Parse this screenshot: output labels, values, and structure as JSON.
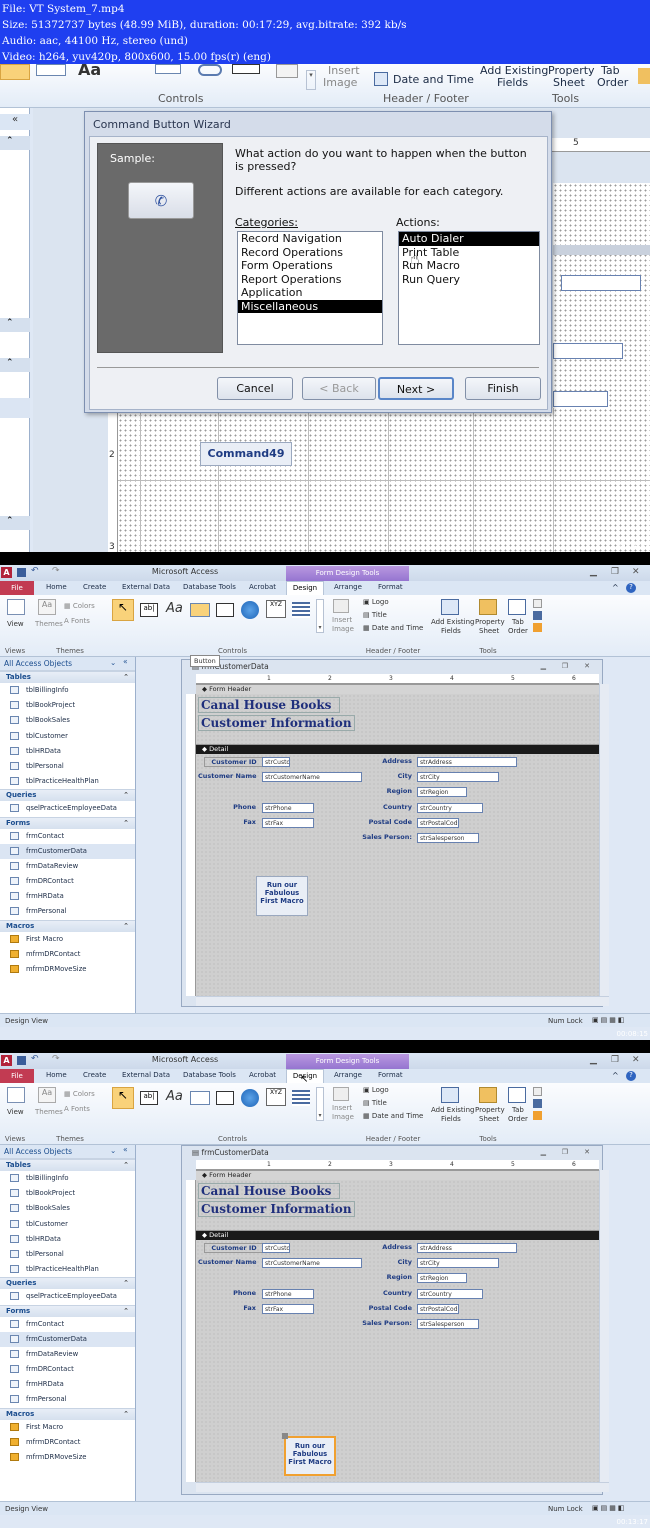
{
  "info": {
    "line1": "File: VT System_7.mp4",
    "line2": "Size: 51372737 bytes (48.99 MiB), duration: 00:17:29, avg.bitrate: 392 kb/s",
    "line3": "Audio: aac, 44100 Hz, stereo (und)",
    "line4": "Video: h264, yuv420p, 800x600, 15.00 fps(r) (eng)"
  },
  "frame1": {
    "timestamp": "00:04:35",
    "ribbon": {
      "insert_image": "Insert",
      "insert_image2": "Image",
      "date_time": "Date and Time",
      "add_fields": "Add Existing",
      "add_fields2": "Fields",
      "property": "Property",
      "property2": "Sheet",
      "tab_order": "Tab",
      "tab_order2": "Order",
      "grp_controls": "Controls",
      "grp_header": "Header / Footer",
      "grp_tools": "Tools"
    },
    "ruler_mark": "5",
    "wizard": {
      "title": "Command Button Wizard",
      "sample_label": "Sample:",
      "question": "What action do you want to happen when the button is pressed?",
      "help": "Different actions are available for each category.",
      "categories_label": "Categories:",
      "actions_label": "Actions:",
      "categories": [
        "Record Navigation",
        "Record Operations",
        "Form Operations",
        "Report Operations",
        "Application",
        "Miscellaneous"
      ],
      "actions": [
        "Auto Dialer",
        "Print Table",
        "Run Macro",
        "Run Query"
      ],
      "cancel": "Cancel",
      "back": "< Back",
      "next": "Next >",
      "finish": "Finish"
    },
    "command_button": "Command49",
    "vruler": [
      "2",
      "3"
    ]
  },
  "access": {
    "app_title": "Microsoft Access",
    "context_tab": "Form Design Tools",
    "tabs": [
      "File",
      "Home",
      "Create",
      "External Data",
      "Database Tools",
      "Acrobat",
      "Design",
      "Arrange",
      "Format"
    ],
    "ribbon": {
      "view": "View",
      "themes": "Themes",
      "colors": "Colors",
      "fonts": "Fonts",
      "insert": "Insert",
      "image": "Image",
      "logo": "Logo",
      "title": "Title",
      "date_time": "Date and Time",
      "add_existing": "Add Existing",
      "fields": "Fields",
      "property": "Property",
      "sheet": "Sheet",
      "tab": "Tab",
      "order": "Order",
      "grp_views": "Views",
      "grp_themes": "Themes",
      "grp_controls": "Controls",
      "grp_header": "Header / Footer",
      "grp_tools": "Tools"
    },
    "nav": {
      "header": "All Access Objects",
      "sections": [
        {
          "title": "Tables",
          "items": [
            "tblBillingInfo",
            "tblBookProject",
            "tblBookSales",
            "tblCustomer",
            "tblHRData",
            "tblPersonal",
            "tblPracticeHealthPlan"
          ]
        },
        {
          "title": "Queries",
          "items": [
            "qselPracticeEmployeeData"
          ]
        },
        {
          "title": "Forms",
          "items": [
            "frmContact",
            "frmCustomerData",
            "frmDataReview",
            "frmDRContact",
            "frmHRData",
            "frmPersonal"
          ]
        },
        {
          "title": "Macros",
          "items": [
            "First Macro",
            "mfrmDRContact",
            "mfrmDRMoveSize"
          ]
        }
      ]
    },
    "form": {
      "title": "frmCustomerData",
      "form_header": "Form Header",
      "detail": "Detail",
      "heading1": "Canal House Books",
      "heading2": "Customer Information",
      "fields": [
        {
          "label": "Customer ID",
          "box": "strCusto"
        },
        {
          "label": "Customer Name",
          "box": "strCustomerName"
        },
        {
          "label": "Phone",
          "box": "strPhone"
        },
        {
          "label": "Fax",
          "box": "strFax"
        },
        {
          "label": "Address",
          "box": "strAddress"
        },
        {
          "label": "City",
          "box": "strCity"
        },
        {
          "label": "Region",
          "box": "strRegion"
        },
        {
          "label": "Country",
          "box": "strCountry"
        },
        {
          "label": "Postal Code",
          "box": "strPostalCod"
        },
        {
          "label": "Sales Person:",
          "box": "strSalesperson"
        }
      ],
      "button_line1": "Run our",
      "button_line2": "Fabulous",
      "button_line3": "First Macro",
      "ruler_nums": [
        "1",
        "2",
        "3",
        "4",
        "5",
        "6"
      ]
    },
    "status_left": "Design View",
    "status_right": "Num Lock"
  },
  "frame2": {
    "timestamp": "00:08:15",
    "tooltip": "Button"
  },
  "frame3": {
    "timestamp": "00:13:17"
  }
}
